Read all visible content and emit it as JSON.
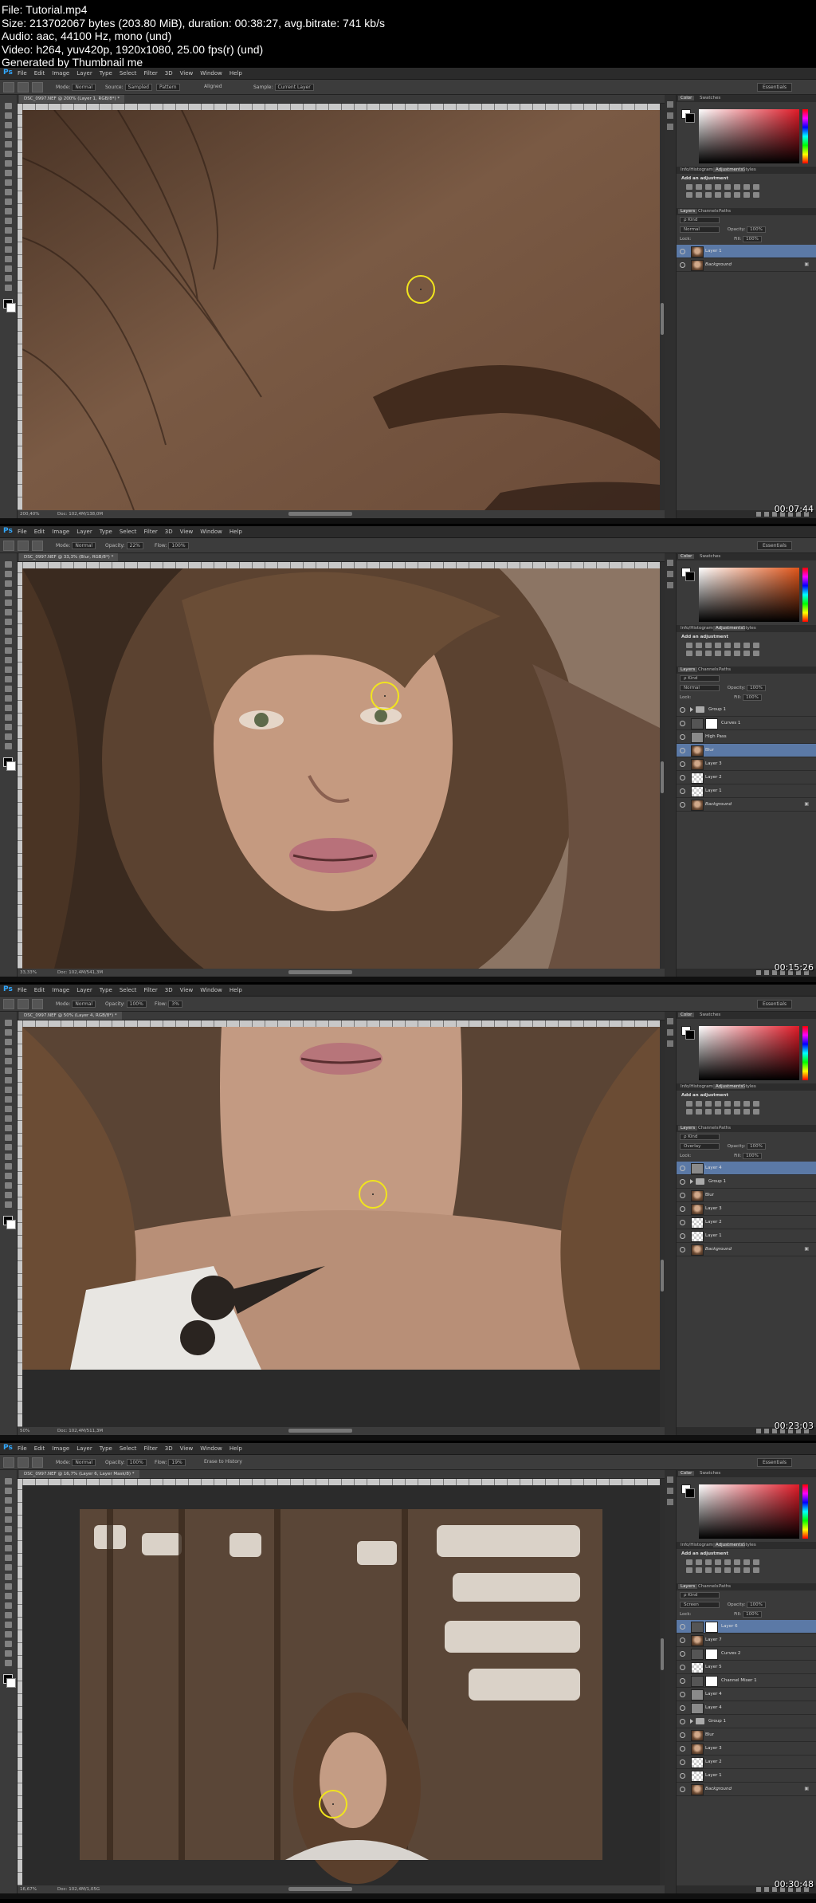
{
  "header": {
    "lines": [
      "File: Tutorial.mp4",
      "Size: 213702067 bytes (203.80 MiB), duration: 00:38:27, avg.bitrate: 741 kb/s",
      "Audio: aac, 44100 Hz, mono (und)",
      "Video: h264, yuv420p, 1920x1080, 25.00 fps(r) (und)",
      "Generated by Thumbnail me"
    ]
  },
  "app": {
    "logo": "Ps",
    "menus": [
      "File",
      "Edit",
      "Image",
      "Layer",
      "Type",
      "Select",
      "Filter",
      "3D",
      "View",
      "Window",
      "Help"
    ],
    "workspace": "Essentials",
    "panel_tabs_top": [
      "Color",
      "Swatches"
    ],
    "panel_tabs_mid": [
      "Info/Histogram",
      "Adjustments",
      "Styles"
    ],
    "panel_tabs_layers": [
      "Layers",
      "Channels",
      "Paths"
    ],
    "add_adjustment": "Add an adjustment",
    "opacity_label": "Opacity:",
    "fill_label": "Fill:",
    "lock_label": "Lock:",
    "kind_label": "ρ Kind"
  },
  "frames": [
    {
      "timestamp": "00:07:44",
      "doc_tab": "DSC_0997.NEF @ 200% (Layer 1, RGB/8*) *",
      "zoom": "200,40%",
      "doc_size": "Doc: 102,4M/138,0M",
      "options": [
        {
          "label": "Mode:",
          "value": "Normal"
        },
        {
          "label": "Source:",
          "value": "Sampled"
        },
        {
          "label": "",
          "value": "Pattern"
        },
        {
          "label": "Aligned",
          "value": ""
        },
        {
          "label": "Sample:",
          "value": "Current Layer"
        }
      ],
      "blend": "Normal",
      "opacity": "100%",
      "fill": "100%",
      "layers": [
        {
          "name": "Layer 1",
          "thumb": "face",
          "selected": true,
          "type": "layer"
        },
        {
          "name": "Background",
          "thumb": "face",
          "selected": false,
          "type": "background"
        }
      ]
    },
    {
      "timestamp": "00:15:26",
      "doc_tab": "DSC_0997.NEF @ 33,3% (Blur, RGB/8*) *",
      "zoom": "33,33%",
      "doc_size": "Doc: 102,4M/541,3M",
      "options": [
        {
          "label": "Mode:",
          "value": "Normal"
        },
        {
          "label": "Opacity:",
          "value": "22%"
        },
        {
          "label": "Flow:",
          "value": "100%"
        }
      ],
      "blend": "Normal",
      "opacity": "100%",
      "fill": "100%",
      "layers": [
        {
          "name": "Group 1",
          "thumb": "folder",
          "selected": false,
          "type": "group"
        },
        {
          "name": "Curves 1",
          "thumb": "mask",
          "selected": false,
          "type": "adjustment"
        },
        {
          "name": "High Pass",
          "thumb": "gray",
          "selected": false,
          "type": "layer"
        },
        {
          "name": "Blur",
          "thumb": "face",
          "selected": true,
          "type": "layer"
        },
        {
          "name": "Layer 3",
          "thumb": "face",
          "selected": false,
          "type": "layer"
        },
        {
          "name": "Layer 2",
          "thumb": "trans",
          "selected": false,
          "type": "layer"
        },
        {
          "name": "Layer 1",
          "thumb": "trans",
          "selected": false,
          "type": "layer"
        },
        {
          "name": "Background",
          "thumb": "face",
          "selected": false,
          "type": "background"
        }
      ]
    },
    {
      "timestamp": "00:23:03",
      "doc_tab": "DSC_0997.NEF @ 50% (Layer 4, RGB/8*) *",
      "zoom": "50%",
      "doc_size": "Doc: 102,4M/511,3M",
      "options": [
        {
          "label": "Mode:",
          "value": "Normal"
        },
        {
          "label": "Opacity:",
          "value": "100%"
        },
        {
          "label": "Flow:",
          "value": "3%"
        }
      ],
      "blend": "Overlay",
      "opacity": "100%",
      "fill": "100%",
      "layers": [
        {
          "name": "Layer 4",
          "thumb": "gray",
          "selected": true,
          "type": "layer"
        },
        {
          "name": "Group 1",
          "thumb": "folder",
          "selected": false,
          "type": "group"
        },
        {
          "name": "Blur",
          "thumb": "face",
          "selected": false,
          "type": "layer"
        },
        {
          "name": "Layer 3",
          "thumb": "face",
          "selected": false,
          "type": "layer"
        },
        {
          "name": "Layer 2",
          "thumb": "trans",
          "selected": false,
          "type": "layer"
        },
        {
          "name": "Layer 1",
          "thumb": "trans",
          "selected": false,
          "type": "layer"
        },
        {
          "name": "Background",
          "thumb": "face",
          "selected": false,
          "type": "background"
        }
      ]
    },
    {
      "timestamp": "00:30:48",
      "doc_tab": "DSC_0997.NEF @ 16,7% (Layer 6, Layer Mask/8) *",
      "zoom": "16,67%",
      "doc_size": "Doc: 102,4M/1,05G",
      "options": [
        {
          "label": "Mode:",
          "value": "Normal"
        },
        {
          "label": "Opacity:",
          "value": "100%"
        },
        {
          "label": "Flow:",
          "value": "19%"
        },
        {
          "label": "Erase to History",
          "value": ""
        }
      ],
      "blend": "Screen",
      "opacity": "100%",
      "fill": "100%",
      "layers": [
        {
          "name": "Layer 6",
          "thumb": "mask",
          "selected": true,
          "type": "layer"
        },
        {
          "name": "Layer 7",
          "thumb": "face",
          "selected": false,
          "type": "layer"
        },
        {
          "name": "Curves 2",
          "thumb": "mask",
          "selected": false,
          "type": "adjustment"
        },
        {
          "name": "Layer 5",
          "thumb": "trans",
          "selected": false,
          "type": "layer"
        },
        {
          "name": "Channel Mixer 1",
          "thumb": "mask",
          "selected": false,
          "type": "adjustment"
        },
        {
          "name": "Layer 4",
          "thumb": "gray",
          "selected": false,
          "type": "layer"
        },
        {
          "name": "Layer 4",
          "thumb": "gray",
          "selected": false,
          "type": "layer"
        },
        {
          "name": "Group 1",
          "thumb": "folder",
          "selected": false,
          "type": "group"
        },
        {
          "name": "Blur",
          "thumb": "face",
          "selected": false,
          "type": "layer"
        },
        {
          "name": "Layer 3",
          "thumb": "face",
          "selected": false,
          "type": "layer"
        },
        {
          "name": "Layer 2",
          "thumb": "trans",
          "selected": false,
          "type": "layer"
        },
        {
          "name": "Layer 1",
          "thumb": "trans",
          "selected": false,
          "type": "layer"
        },
        {
          "name": "Background",
          "thumb": "face",
          "selected": false,
          "type": "background"
        }
      ]
    }
  ]
}
